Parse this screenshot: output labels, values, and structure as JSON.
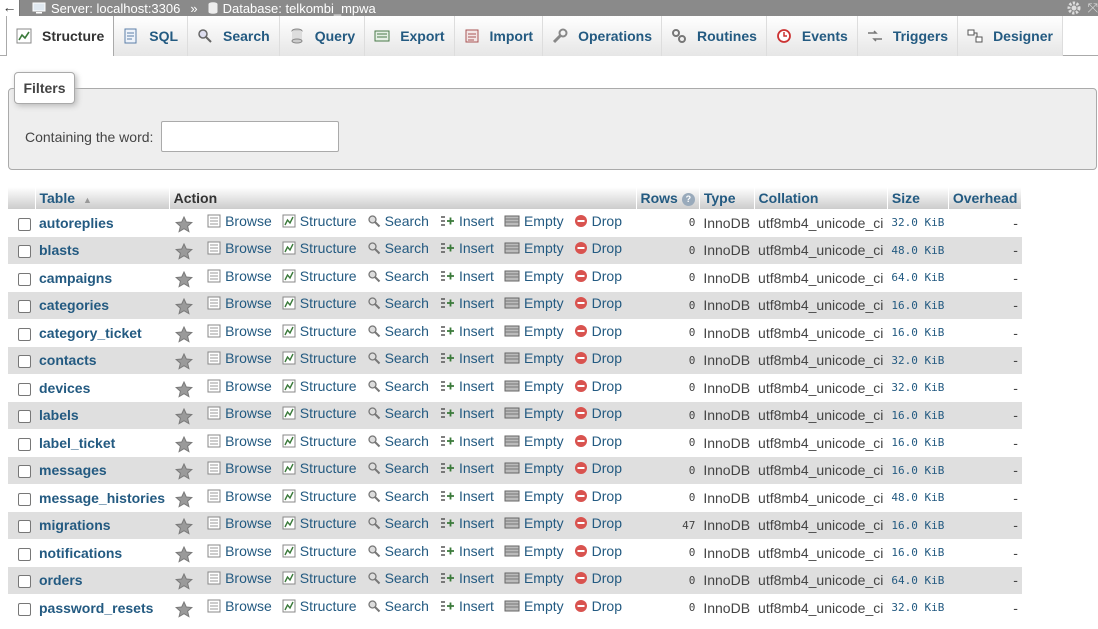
{
  "topbar": {
    "server": "Server: localhost:3306",
    "separator": "»",
    "database": "Database: telkombi_mpwa"
  },
  "tabs": [
    {
      "label": "Structure",
      "icon": "structure-icon",
      "active": true
    },
    {
      "label": "SQL",
      "icon": "sql-icon"
    },
    {
      "label": "Search",
      "icon": "search-icon"
    },
    {
      "label": "Query",
      "icon": "query-icon"
    },
    {
      "label": "Export",
      "icon": "export-icon"
    },
    {
      "label": "Import",
      "icon": "import-icon"
    },
    {
      "label": "Operations",
      "icon": "wrench-icon"
    },
    {
      "label": "Routines",
      "icon": "routines-icon"
    },
    {
      "label": "Events",
      "icon": "clock-icon"
    },
    {
      "label": "Triggers",
      "icon": "triggers-icon"
    },
    {
      "label": "Designer",
      "icon": "designer-icon"
    }
  ],
  "filters": {
    "legend": "Filters",
    "label": "Containing the word:",
    "value": ""
  },
  "table": {
    "headers": {
      "table": "Table",
      "action": "Action",
      "rows": "Rows",
      "type": "Type",
      "collation": "Collation",
      "size": "Size",
      "overhead": "Overhead"
    },
    "actions": [
      "Browse",
      "Structure",
      "Search",
      "Insert",
      "Empty",
      "Drop"
    ],
    "rows": [
      {
        "name": "autoreplies",
        "rows": "0",
        "type": "InnoDB",
        "collation": "utf8mb4_unicode_ci",
        "size": "32.0 KiB",
        "overhead": "-"
      },
      {
        "name": "blasts",
        "rows": "0",
        "type": "InnoDB",
        "collation": "utf8mb4_unicode_ci",
        "size": "48.0 KiB",
        "overhead": "-"
      },
      {
        "name": "campaigns",
        "rows": "0",
        "type": "InnoDB",
        "collation": "utf8mb4_unicode_ci",
        "size": "64.0 KiB",
        "overhead": "-"
      },
      {
        "name": "categories",
        "rows": "0",
        "type": "InnoDB",
        "collation": "utf8mb4_unicode_ci",
        "size": "16.0 KiB",
        "overhead": "-"
      },
      {
        "name": "category_ticket",
        "rows": "0",
        "type": "InnoDB",
        "collation": "utf8mb4_unicode_ci",
        "size": "16.0 KiB",
        "overhead": "-"
      },
      {
        "name": "contacts",
        "rows": "0",
        "type": "InnoDB",
        "collation": "utf8mb4_unicode_ci",
        "size": "32.0 KiB",
        "overhead": "-"
      },
      {
        "name": "devices",
        "rows": "0",
        "type": "InnoDB",
        "collation": "utf8mb4_unicode_ci",
        "size": "32.0 KiB",
        "overhead": "-"
      },
      {
        "name": "labels",
        "rows": "0",
        "type": "InnoDB",
        "collation": "utf8mb4_unicode_ci",
        "size": "16.0 KiB",
        "overhead": "-"
      },
      {
        "name": "label_ticket",
        "rows": "0",
        "type": "InnoDB",
        "collation": "utf8mb4_unicode_ci",
        "size": "16.0 KiB",
        "overhead": "-"
      },
      {
        "name": "messages",
        "rows": "0",
        "type": "InnoDB",
        "collation": "utf8mb4_unicode_ci",
        "size": "16.0 KiB",
        "overhead": "-"
      },
      {
        "name": "message_histories",
        "rows": "0",
        "type": "InnoDB",
        "collation": "utf8mb4_unicode_ci",
        "size": "48.0 KiB",
        "overhead": "-"
      },
      {
        "name": "migrations",
        "rows": "47",
        "type": "InnoDB",
        "collation": "utf8mb4_unicode_ci",
        "size": "16.0 KiB",
        "overhead": "-"
      },
      {
        "name": "notifications",
        "rows": "0",
        "type": "InnoDB",
        "collation": "utf8mb4_unicode_ci",
        "size": "16.0 KiB",
        "overhead": "-"
      },
      {
        "name": "orders",
        "rows": "0",
        "type": "InnoDB",
        "collation": "utf8mb4_unicode_ci",
        "size": "64.0 KiB",
        "overhead": "-"
      },
      {
        "name": "password_resets",
        "rows": "0",
        "type": "InnoDB",
        "collation": "utf8mb4_unicode_ci",
        "size": "32.0 KiB",
        "overhead": "-"
      }
    ]
  },
  "colors": {
    "link": "#235a81",
    "even_row": "#dfdfdf",
    "drop": "#d9534f"
  }
}
